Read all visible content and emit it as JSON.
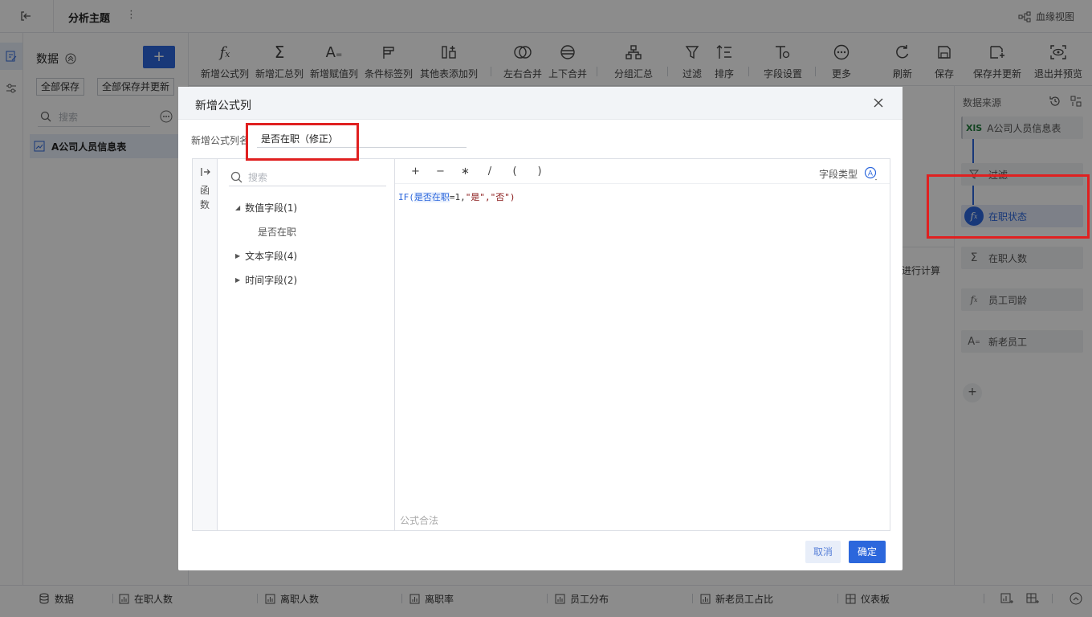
{
  "topbar": {
    "title": "分析主题",
    "lineage_label": "血缘视图"
  },
  "data_panel": {
    "title": "数据",
    "add_label": "+",
    "save_all_label": "全部保存",
    "save_all_update_label": "全部保存并更新",
    "search_placeholder": "搜索",
    "items": [
      {
        "label": "A公司人员信息表"
      }
    ]
  },
  "toolbar": {
    "items": [
      {
        "label": "新增公式列"
      },
      {
        "label": "新增汇总列"
      },
      {
        "label": "新增赋值列"
      },
      {
        "label": "条件标签列"
      },
      {
        "label": "其他表添加列"
      },
      {
        "label": "左右合并"
      },
      {
        "label": "上下合并"
      },
      {
        "label": "分组汇总"
      },
      {
        "label": "过滤"
      },
      {
        "label": "排序"
      },
      {
        "label": "字段设置"
      },
      {
        "label": "更多"
      },
      {
        "label": "刷新"
      },
      {
        "label": "保存"
      },
      {
        "label": "保存并更新"
      },
      {
        "label": "退出并预览"
      }
    ]
  },
  "main": {
    "partial_text": "进行计算"
  },
  "right_panel": {
    "title": "数据来源",
    "nodes": [
      {
        "label": "A公司人员信息表",
        "icon": "xls-icon"
      },
      {
        "label": "过滤",
        "icon": "filter-icon"
      },
      {
        "label": "在职状态",
        "icon": "fx-icon"
      },
      {
        "label": "在职人数",
        "icon": "sigma-icon"
      },
      {
        "label": "员工司龄",
        "icon": "fx-icon"
      },
      {
        "label": "新老员工",
        "icon": "assign-icon"
      }
    ],
    "add_label": "+"
  },
  "bottom_tabs": [
    {
      "label": "数据"
    },
    {
      "label": "在职人数"
    },
    {
      "label": "离职人数"
    },
    {
      "label": "离职率"
    },
    {
      "label": "员工分布"
    },
    {
      "label": "新老员工占比"
    },
    {
      "label": "仪表板"
    }
  ],
  "modal": {
    "title": "新增公式列",
    "name_label": "新增公式列名",
    "name_value": "是否在职（修正）",
    "fn_label_1": "函",
    "fn_label_2": "数",
    "field_search_placeholder": "搜索",
    "tree": {
      "numeric": "数值字段(1)",
      "numeric_child": "是否在职",
      "text": "文本字段(4)",
      "time": "时间字段(2)"
    },
    "operators": [
      "+",
      "−",
      "∗",
      "/",
      "(",
      ")"
    ],
    "field_type_label": "字段类型",
    "formula": {
      "fn": "IF(",
      "field": "是否在职",
      "rest1": "=1,",
      "q1": "\"",
      "yes": "是",
      "q2": "\",\"",
      "no": "否",
      "q3": "\")"
    },
    "validity": "公式合法",
    "cancel_label": "取消",
    "ok_label": "确定"
  },
  "colors": {
    "accent": "#2c67dc",
    "highlight": "#e02020",
    "overlay": "rgba(0,0,0,0.45)"
  }
}
